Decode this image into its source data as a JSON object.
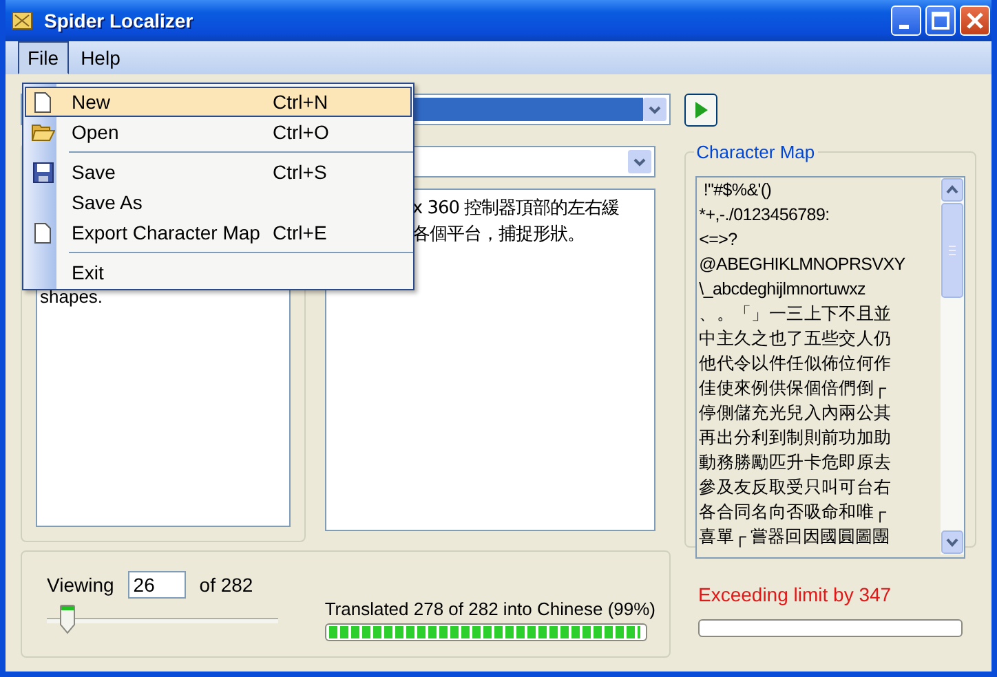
{
  "window": {
    "title": "Spider Localizer"
  },
  "menu_bar": [
    {
      "label": "File",
      "selected": true
    },
    {
      "label": "Help",
      "selected": false
    }
  ],
  "file_menu": {
    "items": [
      {
        "kind": "page-item",
        "label": "New",
        "shortcut": "Ctrl+N",
        "selected": true
      },
      {
        "kind": "folder-item",
        "label": "Open",
        "shortcut": "Ctrl+O",
        "selected": false
      },
      {
        "kind": "separator"
      },
      {
        "kind": "disk-item",
        "label": "Save",
        "shortcut": "Ctrl+S",
        "selected": false
      },
      {
        "kind": "item",
        "label": "Save As",
        "selected": false
      },
      {
        "kind": "page-item",
        "label": "Export Character Map",
        "shortcut": "Ctrl+E",
        "selected": false
      },
      {
        "kind": "separator"
      },
      {
        "kind": "item",
        "label": "Exit",
        "selected": false
      }
    ]
  },
  "source_panel": {
    "text": "shapes."
  },
  "translation_panel": {
    "lines": [
      "x 360 控制器頂部的左右緩",
      "各個平台，捕捉形狀。"
    ]
  },
  "character_map": {
    "title": "Character Map",
    "lines": [
      " !\"#$%&'()",
      "*+,-./0123456789:",
      "<=>?",
      "@ABEGHIKLMNOPRSVXY",
      "\\_abcdeghijlmnortuwxz",
      "、。「」一三上下不且並",
      "中主久之也了五些交人仍",
      "他代令以件任似佈位何作",
      "佳使來例供保個倍們倒┌",
      "停側儲充光兒入內兩公其",
      "再出分利到制則前功加助",
      "動務勝勵匹升卡危即原去",
      "參及友反取受只叫可台右",
      "各合同名向否吸命和唯┌",
      "喜單┌ 嘗器回因國圓圖團"
    ]
  },
  "viewing": {
    "label": "Viewing",
    "value": "26",
    "total": "of 282",
    "level": 0.09
  },
  "progress": {
    "text": "Translated 278 of 282 into Chinese (99%)",
    "level": 0.99
  },
  "limit": {
    "text": "Exceeding limit by 347",
    "level": 0
  }
}
